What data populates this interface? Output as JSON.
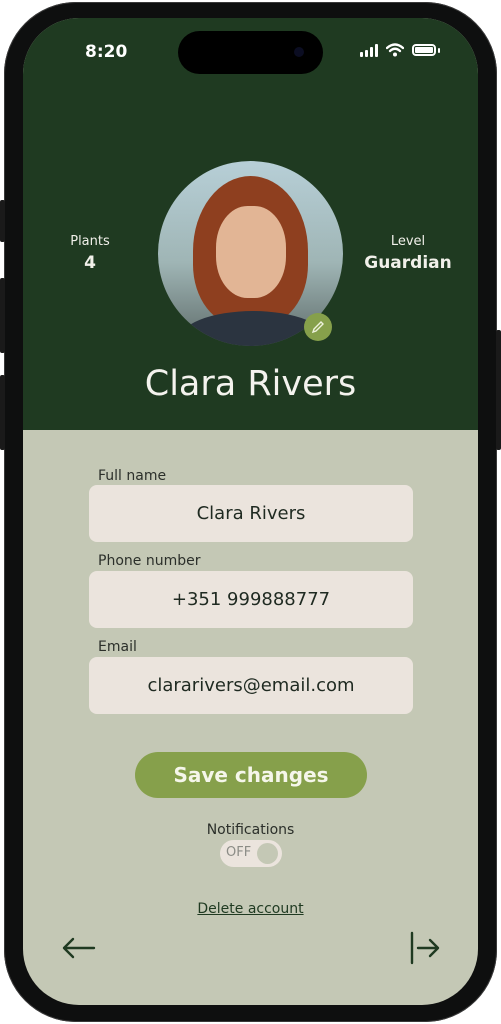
{
  "status_bar": {
    "time": "8:20"
  },
  "profile": {
    "name": "Clara Rivers",
    "stats": [
      {
        "label": "Plants",
        "value": "4"
      },
      {
        "label": "Level",
        "value": "Guardian"
      }
    ]
  },
  "form": {
    "full_name": {
      "label": "Full name",
      "value": "Clara Rivers"
    },
    "phone": {
      "label": "Phone number",
      "value": "+351 999888777"
    },
    "email": {
      "label": "Email",
      "value": "clararivers@email.com"
    }
  },
  "actions": {
    "save_label": "Save changes",
    "notifications_label": "Notifications",
    "notifications_state": "OFF",
    "delete_label": "Delete account"
  },
  "icons": {
    "edit": "pencil-icon",
    "back": "arrow-left-icon",
    "logout": "logout-icon"
  },
  "colors": {
    "header_bg": "#1f3a21",
    "body_bg": "#c4c8b5",
    "accent": "#86a04b",
    "field_bg": "#ebe4dd"
  }
}
